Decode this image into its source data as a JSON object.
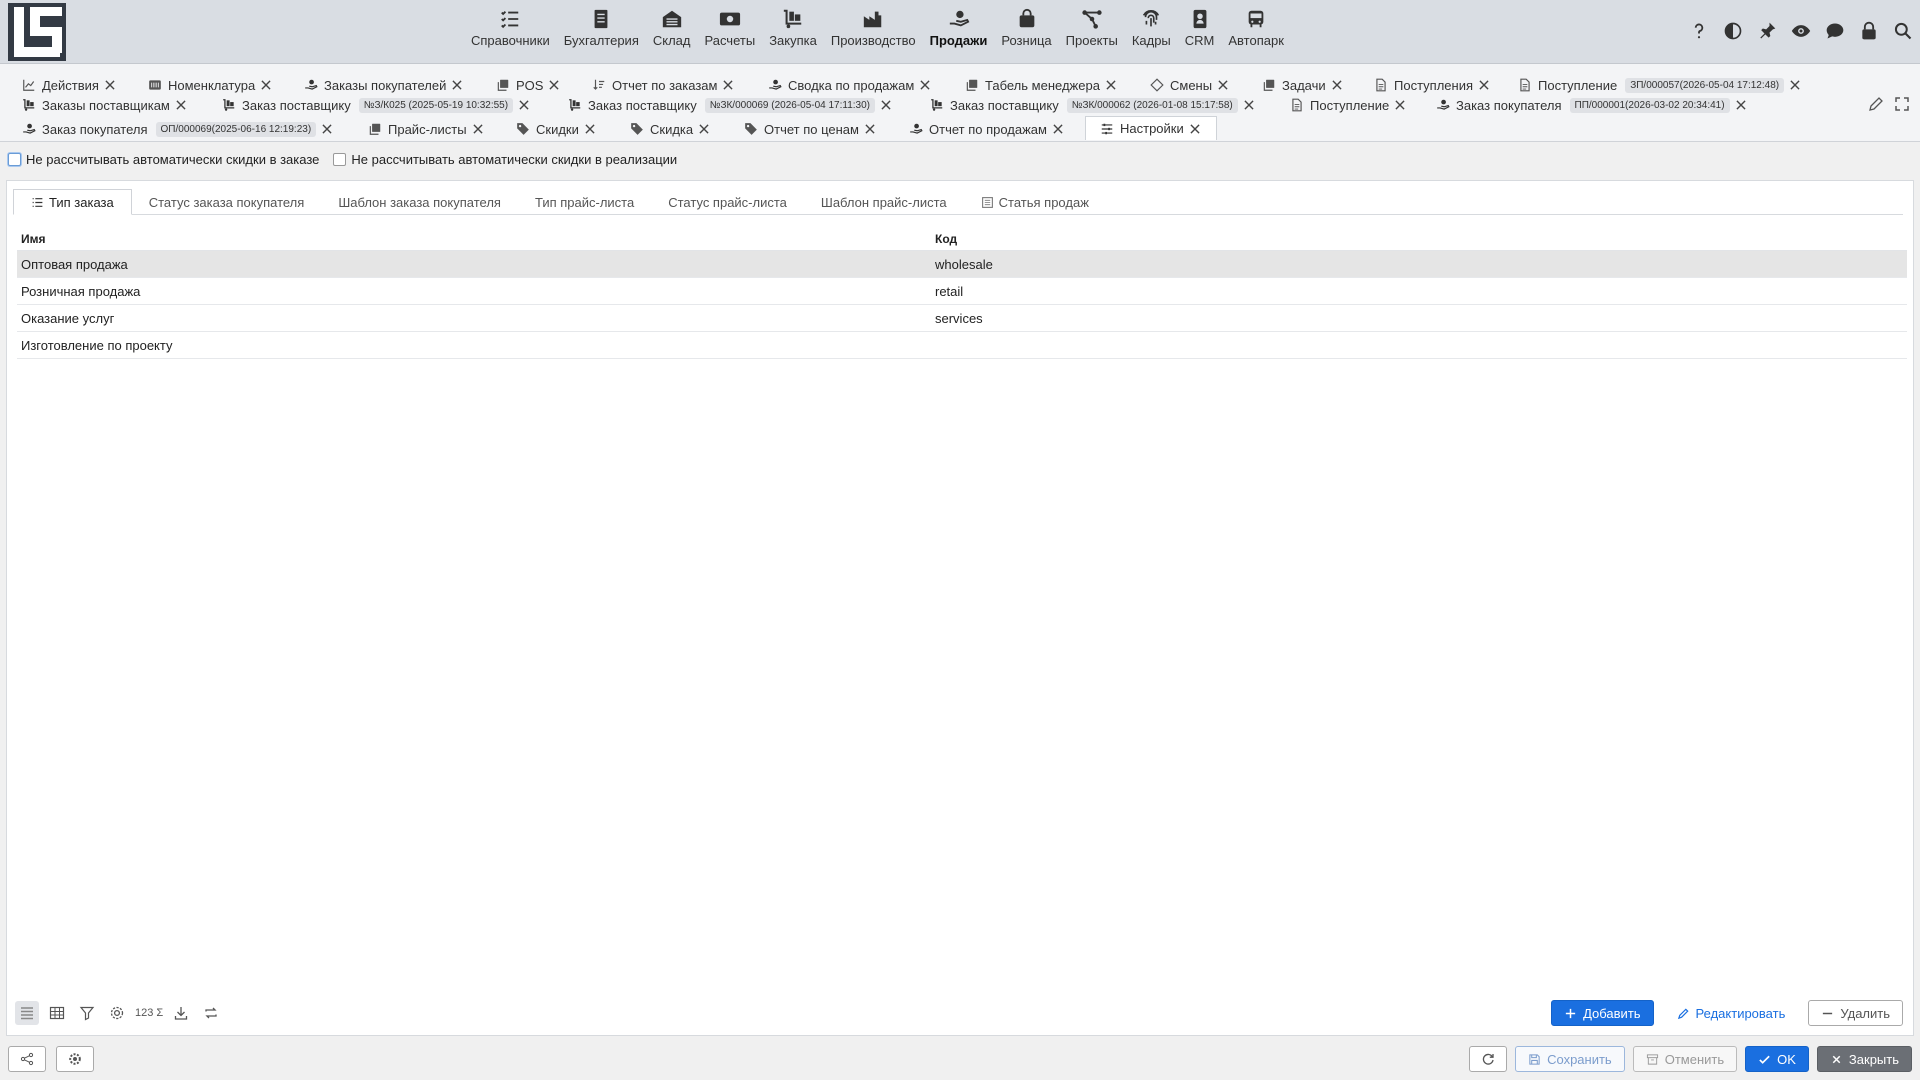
{
  "colors": {
    "accent": "#1a6fe0",
    "topbar": "#d9dde3",
    "selected_row": "#e5e5e5"
  },
  "nav": {
    "modules": [
      {
        "label": "Справочники",
        "icon": "list-check-icon"
      },
      {
        "label": "Бухгалтерия",
        "icon": "ledger-icon"
      },
      {
        "label": "Склад",
        "icon": "warehouse-icon"
      },
      {
        "label": "Расчеты",
        "icon": "money-icon"
      },
      {
        "label": "Закупка",
        "icon": "cart-dolly-icon"
      },
      {
        "label": "Производство",
        "icon": "factory-icon"
      },
      {
        "label": "Продажи",
        "icon": "hand-sale-icon",
        "active": true
      },
      {
        "label": "Розница",
        "icon": "shopping-bag-icon"
      },
      {
        "label": "Проекты",
        "icon": "project-network-icon"
      },
      {
        "label": "Кадры",
        "icon": "fingerprint-icon"
      },
      {
        "label": "CRM",
        "icon": "contact-card-icon"
      },
      {
        "label": "Автопарк",
        "icon": "bus-icon"
      }
    ],
    "tools": [
      "help-icon",
      "contrast-icon",
      "pin-icon",
      "eye-icon",
      "chat-icon",
      "lock-icon",
      "search-icon"
    ]
  },
  "doc_tabs": {
    "row1": [
      {
        "label": "Действия",
        "icon": "chart-icon"
      },
      {
        "label": "Номенклатура",
        "icon": "barcode-icon"
      },
      {
        "label": "Заказы покупателей",
        "icon": "hand-sale-icon"
      },
      {
        "label": "POS",
        "icon": "copy-icon"
      },
      {
        "label": "Отчет по заказам",
        "icon": "sort-icon"
      },
      {
        "label": "Сводка по продажам",
        "icon": "hand-sale-icon"
      },
      {
        "label": "Табель менеджера",
        "icon": "copy-icon"
      },
      {
        "label": "Смены",
        "icon": "diamond-icon"
      },
      {
        "label": "Задачи",
        "icon": "copy-icon"
      },
      {
        "label": "Поступления",
        "icon": "document-icon"
      },
      {
        "label": "Поступление",
        "icon": "document-icon",
        "badge": "ЗП/000057(2026-05-04 17:12:48)"
      }
    ],
    "row2": [
      {
        "label": "Заказы поставщикам",
        "icon": "cart-dolly-icon"
      },
      {
        "label": "Заказ поставщику",
        "icon": "cart-dolly-icon",
        "badge": "№З/К025 (2025-05-19 10:32:55)"
      },
      {
        "label": "Заказ поставщику",
        "icon": "cart-dolly-icon",
        "badge": "№ЗК/000069 (2026-05-04 17:11:30)"
      },
      {
        "label": "Заказ поставщику",
        "icon": "cart-dolly-icon",
        "badge": "№ЗК/000062 (2026-01-08 15:17:58)"
      },
      {
        "label": "Поступление",
        "icon": "document-icon"
      },
      {
        "label": "Заказ покупателя",
        "icon": "hand-sale-icon",
        "badge": "ПП/000001(2026-03-02 20:34:41)"
      }
    ],
    "row3": [
      {
        "label": "Заказ покупателя",
        "icon": "hand-sale-icon",
        "badge": "ОП/000069(2025-06-16 12:19:23)"
      },
      {
        "label": "Прайс-листы",
        "icon": "copy-icon"
      },
      {
        "label": "Скидки",
        "icon": "tag-icon"
      },
      {
        "label": "Скидка",
        "icon": "tag-icon"
      },
      {
        "label": "Отчет по ценам",
        "icon": "tag-icon"
      },
      {
        "label": "Отчет по продажам",
        "icon": "hand-sale-icon"
      },
      {
        "label": "Настройки",
        "icon": "sliders-icon",
        "active": true
      }
    ]
  },
  "options": {
    "no_auto_discount_order": "Не рассчитывать автоматически скидки в заказе",
    "no_auto_discount_sale": "Не рассчитывать автоматически скидки в реализации"
  },
  "subtabs": [
    {
      "label": "Тип заказа",
      "active": true,
      "icon": "list-icon"
    },
    {
      "label": "Статус заказа покупателя"
    },
    {
      "label": "Шаблон заказа покупателя"
    },
    {
      "label": "Тип прайс-листа"
    },
    {
      "label": "Статус прайс-листа"
    },
    {
      "label": "Шаблон прайс-листа"
    },
    {
      "label": "Статья продаж",
      "icon": "article-icon"
    }
  ],
  "grid": {
    "columns": [
      "Имя",
      "Код"
    ],
    "rows": [
      [
        "Оптовая продажа",
        "wholesale"
      ],
      [
        "Розничная продажа",
        "retail"
      ],
      [
        "Оказание услуг",
        "services"
      ],
      [
        "Изготовление по проекту",
        ""
      ]
    ]
  },
  "panel_toolbar": {
    "sum_label": "123 Σ"
  },
  "actions": {
    "add": "Добавить",
    "edit": "Редактировать",
    "delete": "Удалить"
  },
  "footer": {
    "save": "Сохранить",
    "cancel": "Отменить",
    "ok": "OK",
    "close": "Закрыть"
  }
}
